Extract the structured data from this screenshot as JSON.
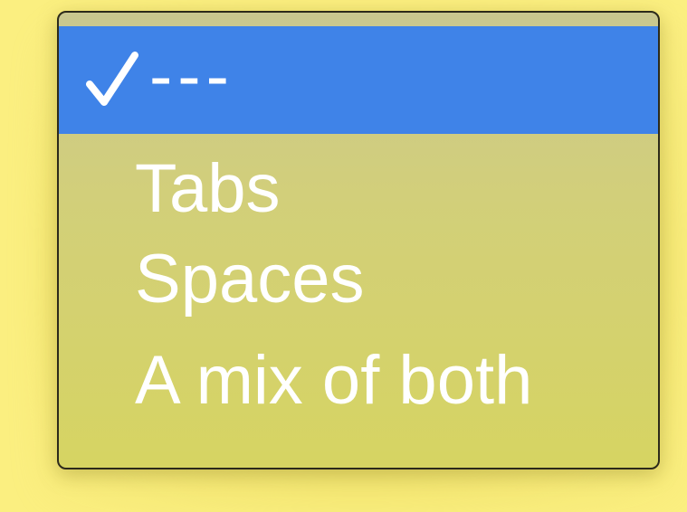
{
  "menu": {
    "items": [
      {
        "label": "---",
        "selected": true,
        "icon": "checkmark-icon"
      },
      {
        "label": "Tabs",
        "selected": false
      },
      {
        "label": "Spaces",
        "selected": false
      },
      {
        "label": "A mix of both",
        "selected": false
      }
    ]
  },
  "colors": {
    "background": "#fbef80",
    "highlight": "#3f83e8",
    "menu_fill": "#d4d26a",
    "text": "#ffffff",
    "border": "#2c2a1a"
  }
}
